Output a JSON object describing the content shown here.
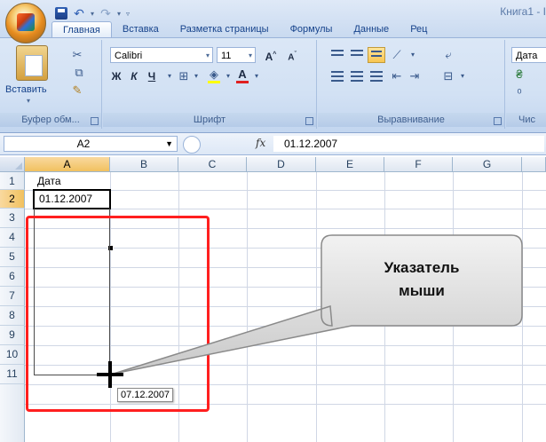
{
  "window": {
    "doc_title": "Книга1 - I"
  },
  "ribbon": {
    "tabs": [
      {
        "label": "Главная",
        "active": true
      },
      {
        "label": "Вставка"
      },
      {
        "label": "Разметка страницы"
      },
      {
        "label": "Формулы"
      },
      {
        "label": "Данные"
      },
      {
        "label": "Рец"
      }
    ],
    "clipboard": {
      "paste_label": "Вставить",
      "group_label": "Буфер обм..."
    },
    "font": {
      "font_name": "Calibri",
      "font_size": "11",
      "bold": "Ж",
      "italic": "К",
      "underline": "Ч",
      "group_label": "Шрифт",
      "font_color": "#e02020",
      "fill_color": "#ffff00"
    },
    "alignment": {
      "group_label": "Выравнивание"
    },
    "number": {
      "format": "Дата",
      "group_label": "Чис"
    }
  },
  "formula_bar": {
    "name_box": "A2",
    "fx": "fx",
    "value": "01.12.2007"
  },
  "grid": {
    "columns": [
      "A",
      "B",
      "C",
      "D",
      "E",
      "F",
      "G"
    ],
    "rows": [
      "1",
      "2",
      "3",
      "4",
      "5",
      "6",
      "7",
      "8",
      "9",
      "10",
      "11"
    ],
    "cells": {
      "A1": "Дата",
      "A2": "01.12.2007"
    }
  },
  "overlay": {
    "tooltip": "07.12.2007",
    "callout_line1": "Указатель",
    "callout_line2": "мыши",
    "highlight_color": "#ff1f1f"
  }
}
